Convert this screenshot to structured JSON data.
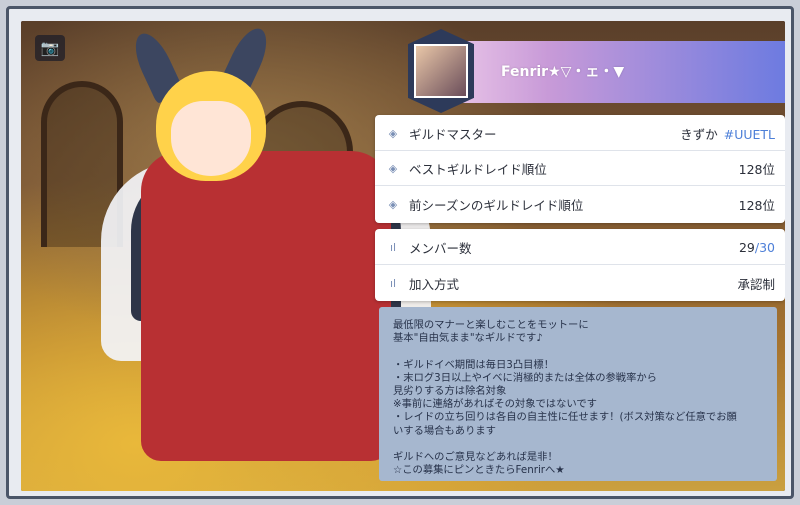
{
  "guild": {
    "name": "Fenrir★▽・ェ・▼",
    "master_label": "ギルドマスター",
    "master_name": "きずか",
    "master_tag": "#UUETL",
    "best_raid_label": "ベストギルドレイド順位",
    "best_raid_value": "128位",
    "prev_raid_label": "前シーズンのギルドレイド順位",
    "prev_raid_value": "128位",
    "members_label": "メンバー数",
    "members_current": "29",
    "members_max": "/30",
    "join_label": "加入方式",
    "join_value": "承認制",
    "description": "最低限のマナーと楽しむことをモットーに\n基本\"自由気まま\"なギルドです♪\n\n・ギルドイベ期間は毎日3凸目標！\n・末ログ3日以上やイベに消極的または全体の参戦率から\n見劣りする方は除名対象\n※事前に連絡があればその対象ではないです\n・レイドの立ち回りは各自の自主性に任せます！(ボス対策など任意でお願\nいする場合もあります\n\nギルドへのご意見などあれば是非！\n☆この募集にピンときたらFenrirへ★"
  },
  "icons": {
    "camera": "📷",
    "diamond": "◈",
    "bars": "ıl"
  },
  "colors": {
    "accent_blue": "#4d7fd8",
    "desc_bg": "#a6b7cf"
  }
}
